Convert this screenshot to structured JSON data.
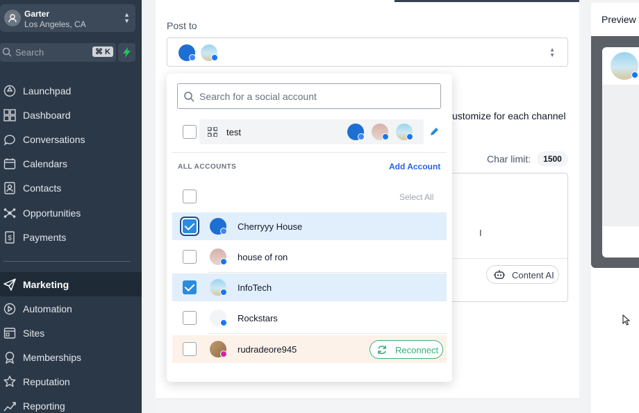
{
  "sidebar": {
    "location": {
      "name": "Garter",
      "city": "Los Angeles, CA"
    },
    "search": {
      "placeholder": "Search",
      "shortcut": "⌘ K"
    },
    "items": [
      {
        "label": "Launchpad",
        "icon": "rocket-icon"
      },
      {
        "label": "Dashboard",
        "icon": "grid-icon"
      },
      {
        "label": "Conversations",
        "icon": "chat-icon"
      },
      {
        "label": "Calendars",
        "icon": "calendar-icon"
      },
      {
        "label": "Contacts",
        "icon": "contacts-icon"
      },
      {
        "label": "Opportunities",
        "icon": "network-icon"
      },
      {
        "label": "Payments",
        "icon": "receipt-icon"
      },
      {
        "label": "Marketing",
        "icon": "send-icon",
        "active": true
      },
      {
        "label": "Automation",
        "icon": "play-circle-icon"
      },
      {
        "label": "Sites",
        "icon": "sites-icon"
      },
      {
        "label": "Memberships",
        "icon": "award-icon"
      },
      {
        "label": "Reputation",
        "icon": "star-icon"
      },
      {
        "label": "Reporting",
        "icon": "chart-line-icon"
      }
    ]
  },
  "composer": {
    "post_to_label": "Post to",
    "customize_text": "ustomize for each channel",
    "char_limit_label": "Char limit:",
    "char_limit_value": "1500",
    "content_ai_label": "Content AI"
  },
  "preview": {
    "label": "Preview"
  },
  "dropdown": {
    "search_placeholder": "Search for a social account",
    "group": {
      "label": "test"
    },
    "section_label": "ALL ACCOUNTS",
    "add_account_label": "Add Account",
    "select_all_label": "Select All",
    "accounts": [
      {
        "name": "Cherryyy House",
        "checked": true,
        "network": "google-business"
      },
      {
        "name": "house of ron",
        "checked": false,
        "network": "facebook"
      },
      {
        "name": "InfoTech",
        "checked": true,
        "network": "facebook"
      },
      {
        "name": "Rockstars",
        "checked": false,
        "network": "facebook"
      },
      {
        "name": "rudradeore945",
        "checked": false,
        "network": "instagram",
        "action": "Reconnect"
      }
    ]
  },
  "colors": {
    "sidebar_bg": "#2b3848",
    "accent_blue": "#2b8bdc",
    "link_blue": "#2563eb",
    "reconnect_green": "#34b17a",
    "facebook_blue": "#1877f2"
  }
}
